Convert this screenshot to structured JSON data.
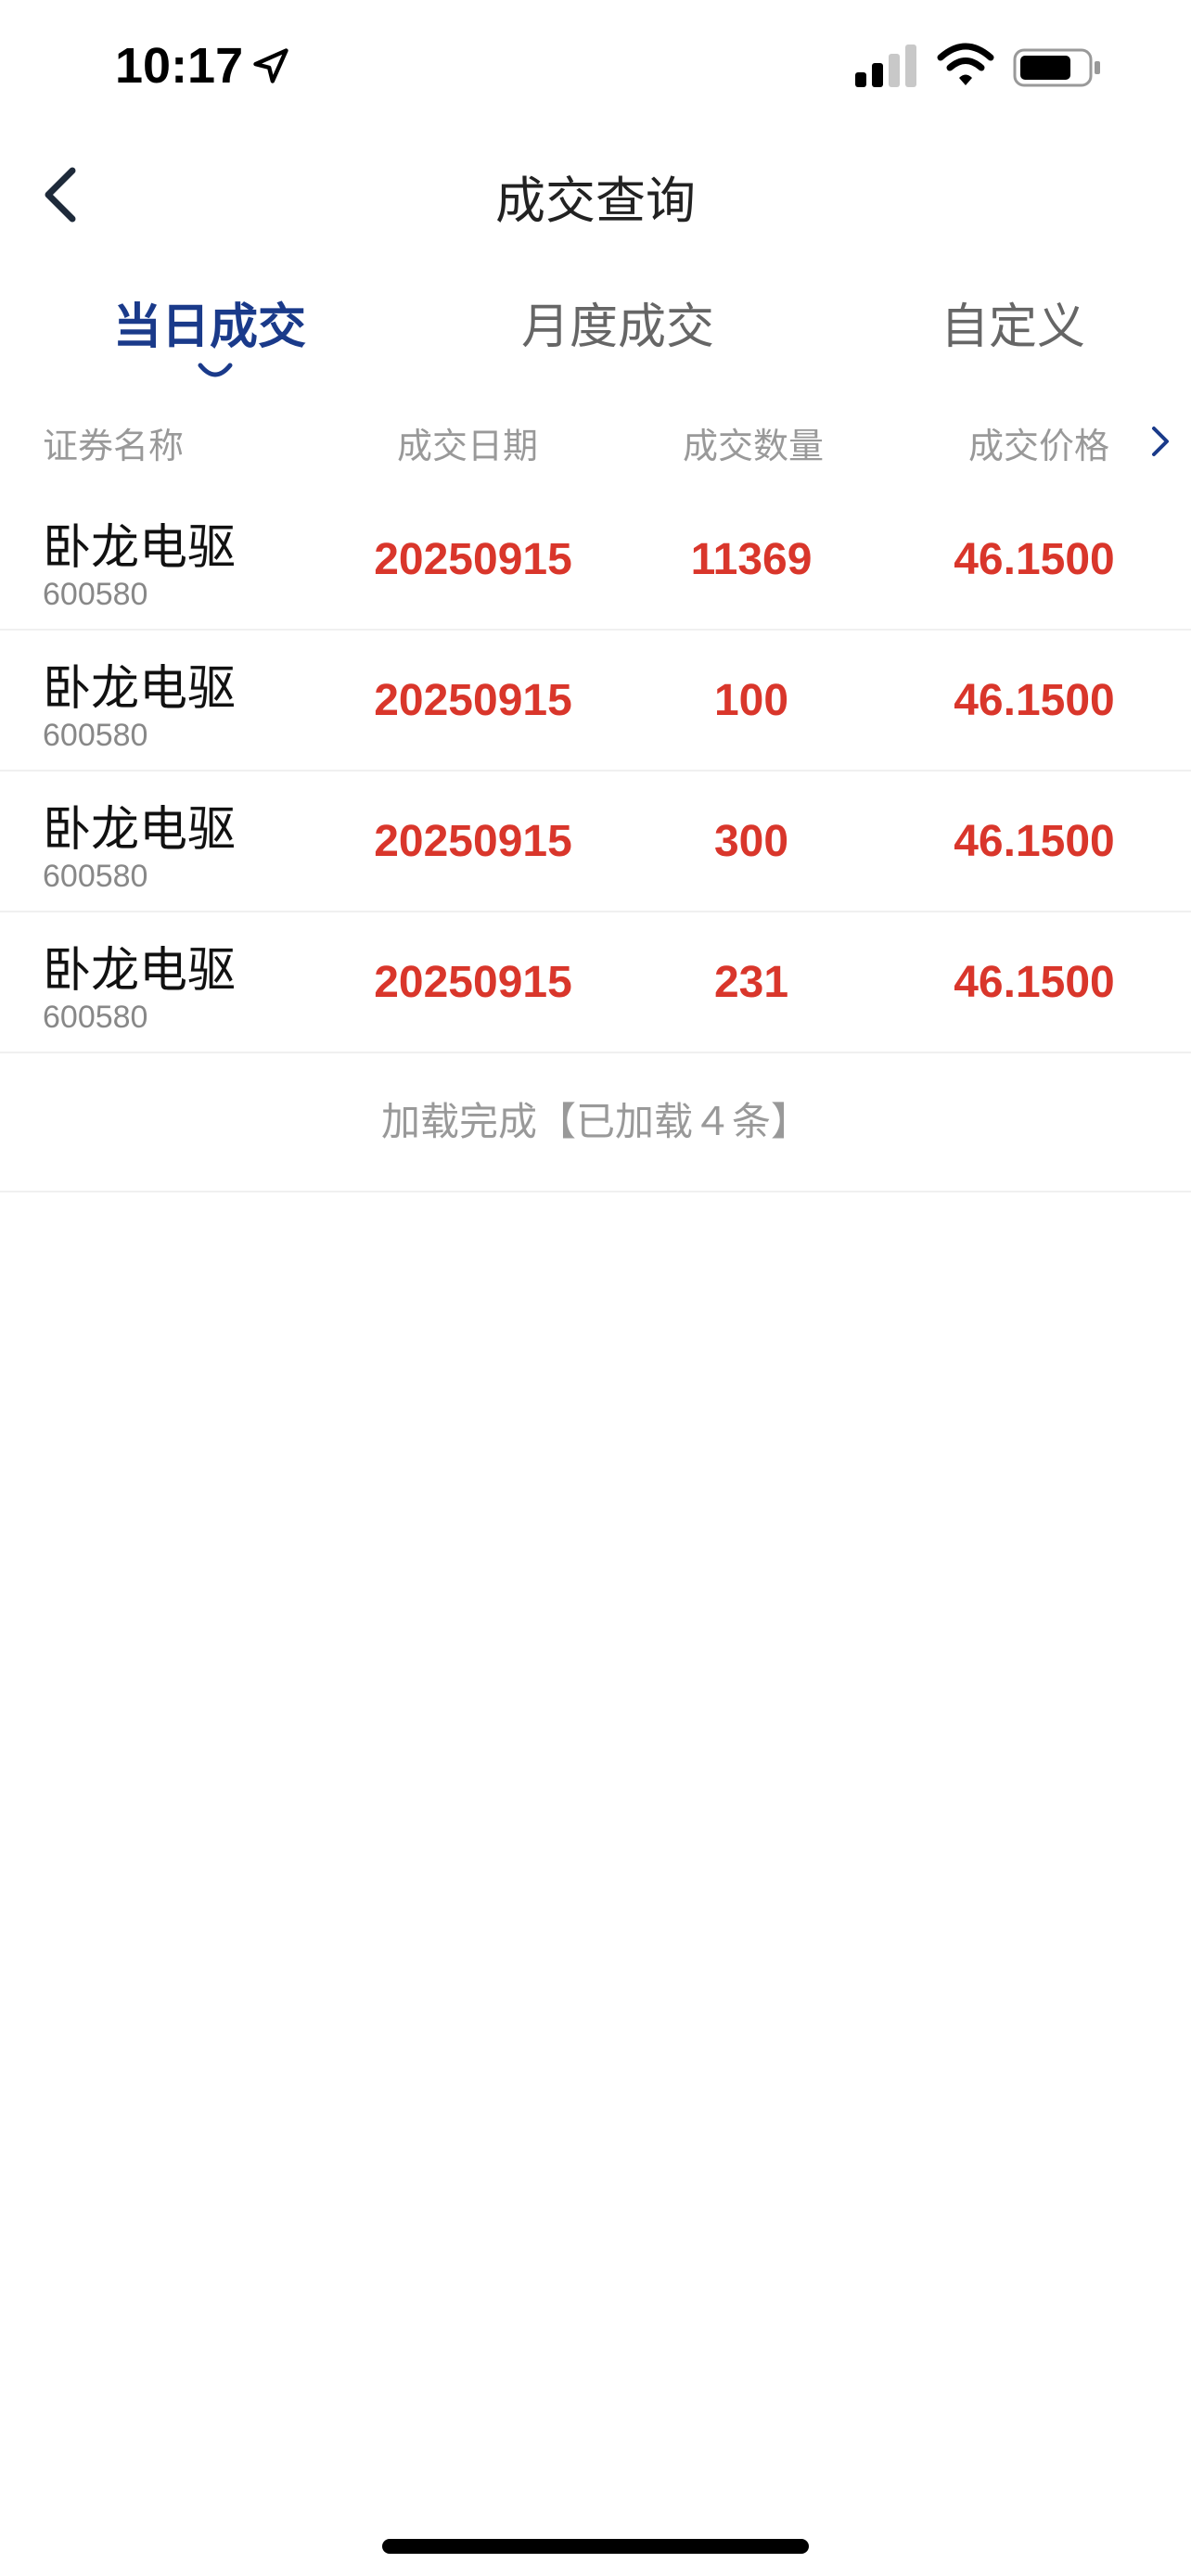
{
  "status_bar": {
    "time": "10:17"
  },
  "nav": {
    "title": "成交查询"
  },
  "tabs": [
    {
      "label": "当日成交",
      "active": true
    },
    {
      "label": "月度成交",
      "active": false
    },
    {
      "label": "自定义",
      "active": false
    }
  ],
  "table": {
    "headers": [
      "证券名称",
      "成交日期",
      "成交数量",
      "成交价格"
    ],
    "rows": [
      {
        "name": "卧龙电驱",
        "code": "600580",
        "date": "20250915",
        "quantity": "11369",
        "price": "46.1500"
      },
      {
        "name": "卧龙电驱",
        "code": "600580",
        "date": "20250915",
        "quantity": "100",
        "price": "46.1500"
      },
      {
        "name": "卧龙电驱",
        "code": "600580",
        "date": "20250915",
        "quantity": "300",
        "price": "46.1500"
      },
      {
        "name": "卧龙电驱",
        "code": "600580",
        "date": "20250915",
        "quantity": "231",
        "price": "46.1500"
      }
    ]
  },
  "load_status": "加载完成【已加载４条】",
  "colors": {
    "accent": "#1a3a8a",
    "value_red": "#d9362b"
  }
}
